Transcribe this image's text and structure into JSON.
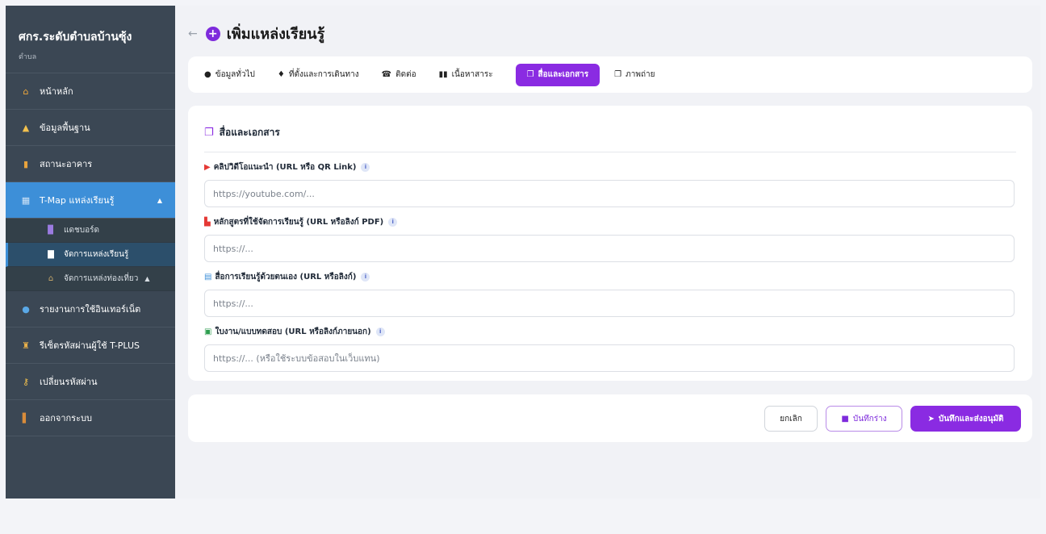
{
  "sidebar": {
    "brand_name": "ศกร.ระดับตำบลบ้านซุ้ง",
    "brand_sub": "ตำบล",
    "items": [
      {
        "label": "หน้าหลัก",
        "icon": "home-icon"
      },
      {
        "label": "ข้อมูลพื้นฐาน",
        "icon": "info-house-icon"
      },
      {
        "label": "สถานะอาคาร",
        "icon": "building-icon"
      },
      {
        "label": "T-Map แหล่งเรียนรู้",
        "icon": "map-icon"
      },
      {
        "label": "รายงานการใช้อินเทอร์เน็ต",
        "icon": "globe-icon"
      },
      {
        "label": "รีเซ็ตรหัสผ่านผู้ใช้ T-PLUS",
        "icon": "user-lock-icon"
      },
      {
        "label": "เปลี่ยนรหัสผ่าน",
        "icon": "key-icon"
      },
      {
        "label": "ออกจากระบบ",
        "icon": "door-icon"
      }
    ],
    "subitems": [
      {
        "label": "แดชบอร์ด",
        "icon": "chart-icon"
      },
      {
        "label": "จัดการแหล่งเรียนรู้",
        "icon": "book-icon"
      },
      {
        "label": "จัดการแหล่งท่องเที่ยว",
        "icon": "landmark-icon"
      }
    ]
  },
  "header": {
    "title": "เพิ่มแหล่งเรียนรู้",
    "back_glyph": "←",
    "plus_glyph": "+"
  },
  "tabs": [
    {
      "label": "ข้อมูลทั่วไป",
      "icon": "info-circle-icon"
    },
    {
      "label": "ที่ตั้งและการเดินทาง",
      "icon": "map-pin-icon"
    },
    {
      "label": "ติดต่อ",
      "icon": "phone-icon"
    },
    {
      "label": "เนื้อหาสาระ",
      "icon": "book-open-icon"
    },
    {
      "label": "สื่อและเอกสาร",
      "icon": "media-icon"
    },
    {
      "label": "ภาพถ่าย",
      "icon": "images-icon"
    }
  ],
  "active_tab": "สื่อและเอกสาร",
  "section": {
    "title": "สื่อและเอกสาร",
    "fields": [
      {
        "label": "คลิปวิดีโอแนะนำ (URL หรือ QR Link)",
        "placeholder": "https://youtube.com/...",
        "icon": "youtube-icon",
        "icon_color": "#e53935"
      },
      {
        "label": "หลักสูตรที่ใช้จัดการเรียนรู้ (URL หรือลิงก์ PDF)",
        "placeholder": "https://...",
        "icon": "pdf-icon",
        "icon_color": "#e53935"
      },
      {
        "label": "สื่อการเรียนรู้ด้วยตนเอง (URL หรือลิงก์)",
        "placeholder": "https://...",
        "icon": "tablet-icon",
        "icon_color": "#3d8fd8"
      },
      {
        "label": "ใบงาน/แบบทดสอบ (URL หรือลิงก์ภายนอก)",
        "placeholder": "https://... (หรือใช้ระบบข้อสอบในเว็บแทน)",
        "icon": "clipboard-icon",
        "icon_color": "#2e9e4f"
      }
    ],
    "info_glyph": "i"
  },
  "footer": {
    "cancel_label": "ยกเลิก",
    "draft_label": "บันทึกร่าง",
    "submit_label": "บันทึกและส่งอนุมัติ"
  },
  "colors": {
    "accent": "#8a2be2",
    "sidebar_bg": "#3b4754",
    "sidebar_active": "#3d8fd8"
  }
}
